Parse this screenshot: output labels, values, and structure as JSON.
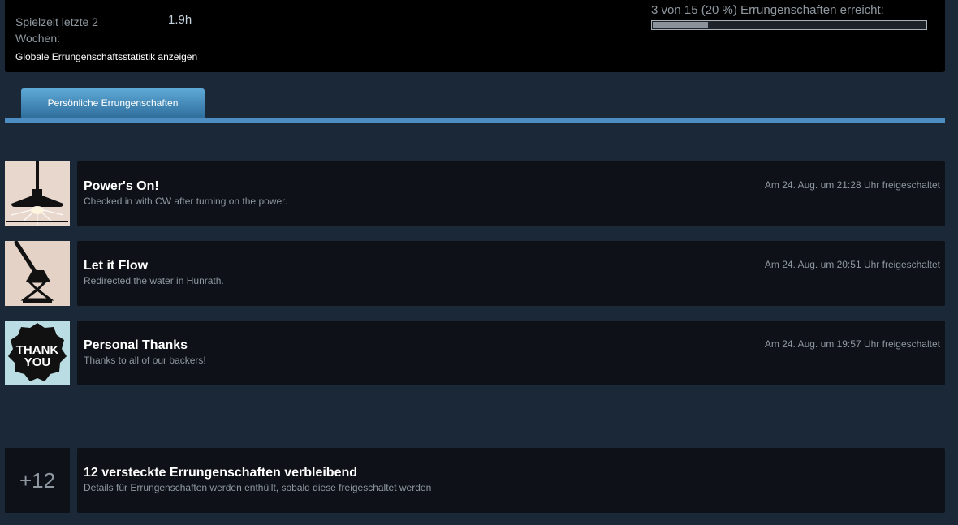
{
  "header": {
    "playtime_label": "Spielzeit letzte 2 Wochen:",
    "playtime_value": "1.9h",
    "global_stats_link": "Globale Errungenschaftsstatistik anzeigen",
    "progress_text": "3 von 15 (20 %) Errungenschaften erreicht:",
    "progress_fraction": 0.2
  },
  "tabs": {
    "personal": "Persönliche Errungenschaften"
  },
  "achievements": [
    {
      "title": "Power's On!",
      "description": "Checked in with CW after turning on the power.",
      "unlock_text": "Am 24. Aug. um 21:28 Uhr freigeschaltet",
      "icon": "ceiling-lamp-icon"
    },
    {
      "title": "Let it Flow",
      "description": "Redirected the water in Hunrath.",
      "unlock_text": "Am 24. Aug. um 20:51 Uhr freigeschaltet",
      "icon": "valve-lever-icon"
    },
    {
      "title": "Personal Thanks",
      "description": "Thanks to all of our backers!",
      "unlock_text": "Am 24. Aug. um 19:57 Uhr freigeschaltet",
      "icon": "thank-you-badge-icon",
      "icon_text_1": "THANK",
      "icon_text_2": "YOU"
    }
  ],
  "hidden": {
    "count_label": "+12",
    "title": "12 versteckte Errungenschaften verbleibend",
    "description": "Details für Errungenschaften werden enthüllt, sobald diese freigeschaltet werden"
  }
}
